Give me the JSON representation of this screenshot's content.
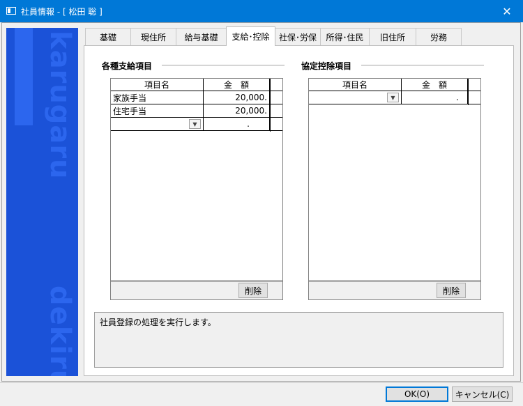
{
  "window": {
    "title": "社員情報 - [ 松田 聡 ]",
    "close_glyph": "✕"
  },
  "sidebar": {
    "brand_top": "karugaru",
    "brand_bottom": "dekiru",
    "color": "#1b52d8"
  },
  "tabs": [
    "基礎",
    "現住所",
    "給与基礎",
    "支給･控除",
    "社保･労保",
    "所得･住民",
    "旧住所",
    "労務"
  ],
  "active_tab": "支給･控除",
  "left_group": {
    "title": "各種支給項目",
    "columns": [
      "項目名",
      "金　額"
    ],
    "rows": [
      {
        "name": "家族手当",
        "amount": "20,000."
      },
      {
        "name": "住宅手当",
        "amount": "20,000."
      }
    ],
    "new_row_amount": ".",
    "delete_label": "削除"
  },
  "right_group": {
    "title": "協定控除項目",
    "columns": [
      "項目名",
      "金　額"
    ],
    "rows": [],
    "new_row_amount": ".",
    "delete_label": "削除"
  },
  "status_message": "社員登録の処理を実行します。",
  "buttons": {
    "ok": "OK(O)",
    "cancel": "キャンセル(C)"
  }
}
